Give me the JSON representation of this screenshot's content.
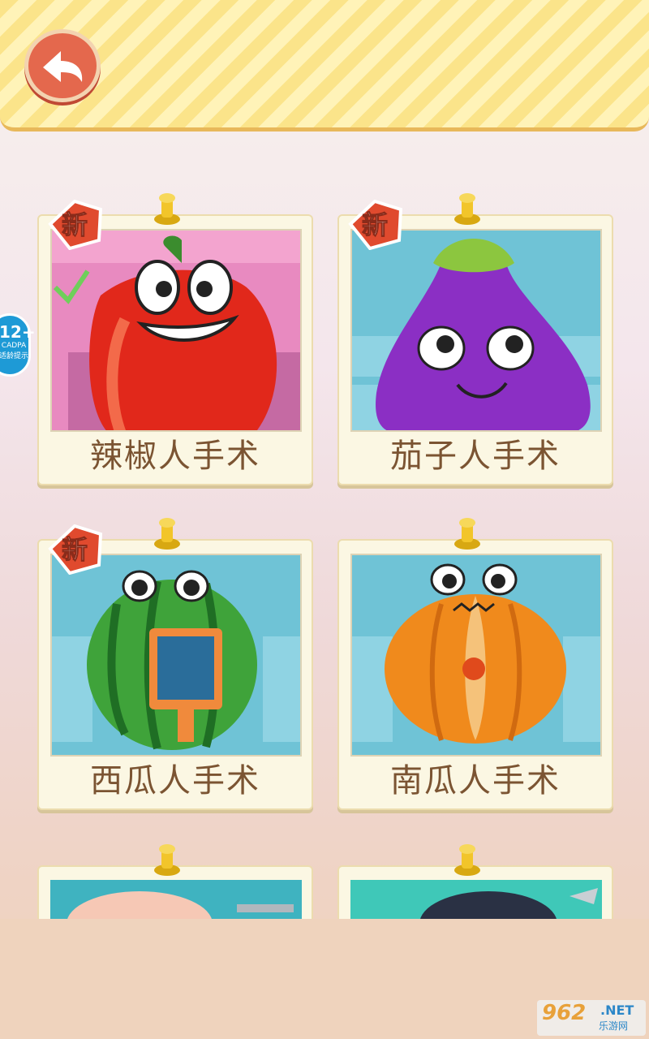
{
  "header": {
    "back_label": "back"
  },
  "age_badge": {
    "rating": "12+",
    "line1": "CADPA",
    "line2": "适龄提示"
  },
  "new_tag_text": "新",
  "cards": [
    {
      "label": "辣椒人手术",
      "is_new": true
    },
    {
      "label": "茄子人手术",
      "is_new": true
    },
    {
      "label": "西瓜人手术",
      "is_new": true
    },
    {
      "label": "南瓜人手术",
      "is_new": false
    }
  ],
  "watermark": {
    "brand": "962",
    "domain": ".NET",
    "subtitle": "乐游网"
  },
  "icons": {
    "back": "back-arrow-icon",
    "pin": "pushpin-icon"
  },
  "colors": {
    "header_stripe_a": "#fbe48a",
    "header_stripe_b": "#fff3b8",
    "back_button": "#e4684d",
    "card_bg": "#fbf7e3",
    "label_text": "#7b5432",
    "new_tag": "#e04a2e"
  }
}
